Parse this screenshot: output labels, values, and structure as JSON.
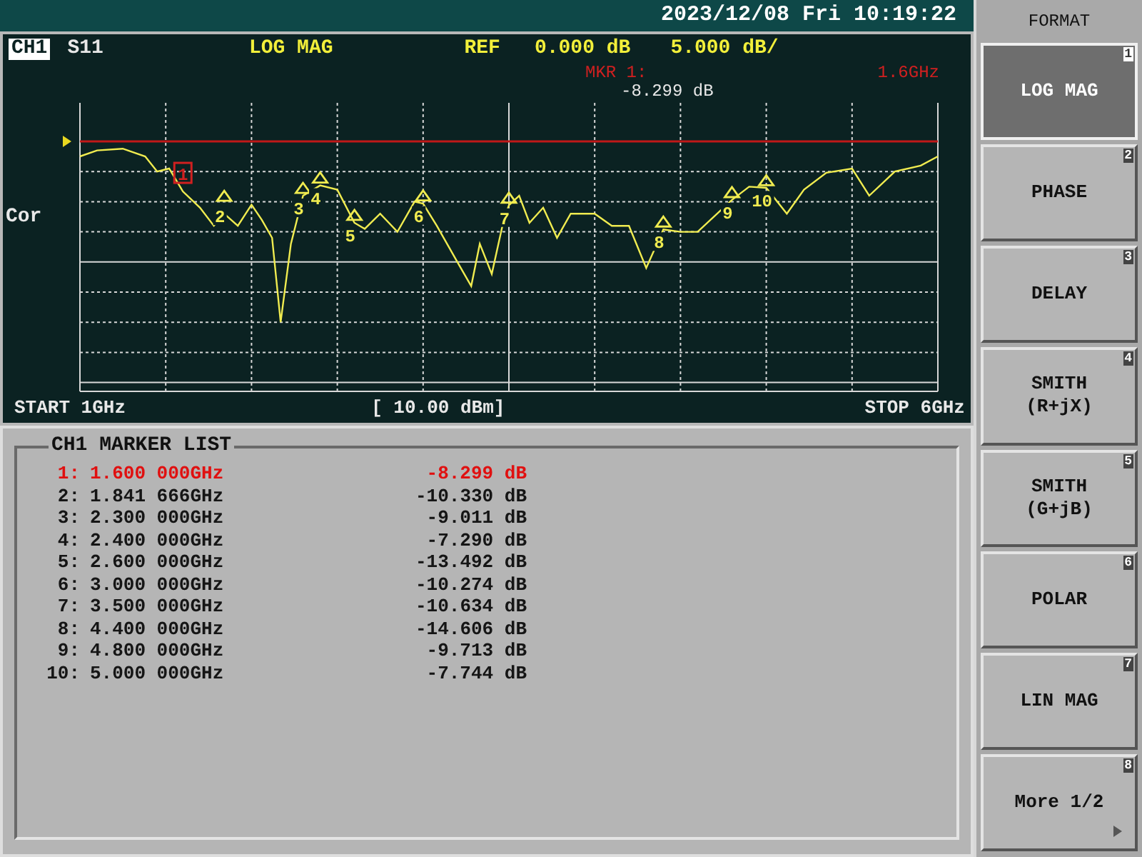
{
  "status_bar": {
    "datetime": "2023/12/08 Fri 10:19:22"
  },
  "trace_header": {
    "channel": "CH1",
    "parameter": "S11",
    "format": "LOG MAG",
    "ref_label": "REF",
    "ref_value": "0.000 dB",
    "scale": "5.000 dB/"
  },
  "marker_readout": {
    "label": "MKR  1:",
    "frequency": "1.6GHz",
    "value": "-8.299 dB"
  },
  "side_label": "Cor",
  "chart": {
    "markers": [
      {
        "label": "1",
        "selected": true
      },
      {
        "label": "2",
        "selected": false
      },
      {
        "label": "3",
        "selected": false
      },
      {
        "label": "4",
        "selected": false
      },
      {
        "label": "5",
        "selected": false
      },
      {
        "label": "6",
        "selected": false
      },
      {
        "label": "7",
        "selected": false
      },
      {
        "label": "8",
        "selected": false
      },
      {
        "label": "9",
        "selected": false
      },
      {
        "label": "10",
        "selected": false
      }
    ]
  },
  "sweep": {
    "start": "START 1GHz",
    "power": "[ 10.00 dBm]",
    "stop": "STOP 6GHz"
  },
  "marker_list": {
    "title": "CH1 MARKER LIST",
    "rows": [
      {
        "index": "1:",
        "frequency": "1.600 000GHz",
        "value": "-8.299 dB",
        "selected": true
      },
      {
        "index": "2:",
        "frequency": "1.841 666GHz",
        "value": "-10.330 dB",
        "selected": false
      },
      {
        "index": "3:",
        "frequency": "2.300 000GHz",
        "value": "-9.011 dB",
        "selected": false
      },
      {
        "index": "4:",
        "frequency": "2.400 000GHz",
        "value": "-7.290 dB",
        "selected": false
      },
      {
        "index": "5:",
        "frequency": "2.600 000GHz",
        "value": "-13.492 dB",
        "selected": false
      },
      {
        "index": "6:",
        "frequency": "3.000 000GHz",
        "value": "-10.274 dB",
        "selected": false
      },
      {
        "index": "7:",
        "frequency": "3.500 000GHz",
        "value": "-10.634 dB",
        "selected": false
      },
      {
        "index": "8:",
        "frequency": "4.400 000GHz",
        "value": "-14.606 dB",
        "selected": false
      },
      {
        "index": "9:",
        "frequency": "4.800 000GHz",
        "value": "-9.713 dB",
        "selected": false
      },
      {
        "index": "10:",
        "frequency": "5.000 000GHz",
        "value": "-7.744 dB",
        "selected": false
      }
    ]
  },
  "softkeys": {
    "title": "FORMAT",
    "keys": [
      {
        "label": "LOG MAG",
        "number": "1",
        "selected": true
      },
      {
        "label": "PHASE",
        "number": "2",
        "selected": false
      },
      {
        "label": "DELAY",
        "number": "3",
        "selected": false
      },
      {
        "label": "SMITH\n(R+jX)",
        "number": "4",
        "selected": false
      },
      {
        "label": "SMITH\n(G+jB)",
        "number": "5",
        "selected": false
      },
      {
        "label": "POLAR",
        "number": "6",
        "selected": false
      },
      {
        "label": "LIN MAG",
        "number": "7",
        "selected": false
      },
      {
        "label": "More 1/2",
        "number": "8",
        "selected": false,
        "submenu": true
      }
    ]
  }
}
